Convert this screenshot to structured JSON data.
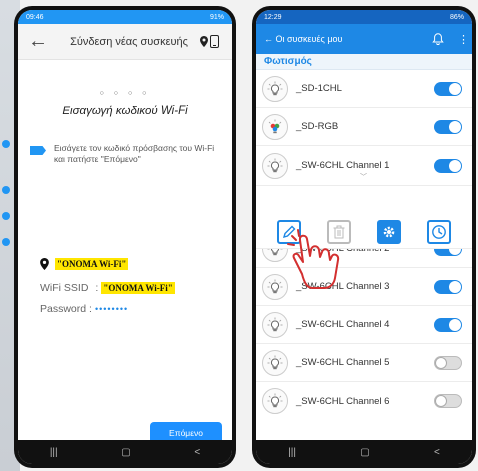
{
  "phone1": {
    "status": {
      "time": "09:46",
      "battery": "91%"
    },
    "header": {
      "back_glyph": "←",
      "title": "Σύνδεση νέας συσκευής"
    },
    "step_dots": "○ ○ ○ ○",
    "heading": "Εισαγωγή κωδικού Wi-Fi",
    "hint": "Εισάγετε τον κωδικό πρόσβασης του Wi-Fi και πατήστε \"Επόμενο\"",
    "network_name": "\"ONOMA Wi-Fi\"",
    "ssid_label": "WiFi SSID",
    "ssid_separator": ":",
    "ssid_value": "\"ONOMA Wi-Fi\"",
    "password_label": "Password :",
    "password_value": "••••••••",
    "next_label": "Επόμενο",
    "nav": [
      "|||",
      "▢",
      "<"
    ]
  },
  "phone2": {
    "status": {
      "time": "12:29",
      "battery": "86%"
    },
    "header": {
      "back_label": "← Οι συσκευές μου"
    },
    "section": "Φωτισμός",
    "devices": [
      {
        "name": "_SD-1CHL",
        "on": true
      },
      {
        "name": "_SD-RGB",
        "on": true
      },
      {
        "name": "_SW-6CHL Channel 1",
        "on": true
      },
      {
        "name": "_SW-6CHL Channel 2",
        "on": true
      },
      {
        "name": "_SW-6CHL Channel 3",
        "on": true
      },
      {
        "name": "_SW-6CHL Channel 4",
        "on": true
      },
      {
        "name": "_SW-6CHL Channel 5",
        "on": false
      },
      {
        "name": "_SW-6CHL Channel 6",
        "on": false
      }
    ],
    "nav": [
      "|||",
      "▢",
      "<"
    ]
  },
  "colors": {
    "accent": "#1e88e5",
    "highlight": "#ffe600",
    "status_bar": "#2196f3"
  }
}
